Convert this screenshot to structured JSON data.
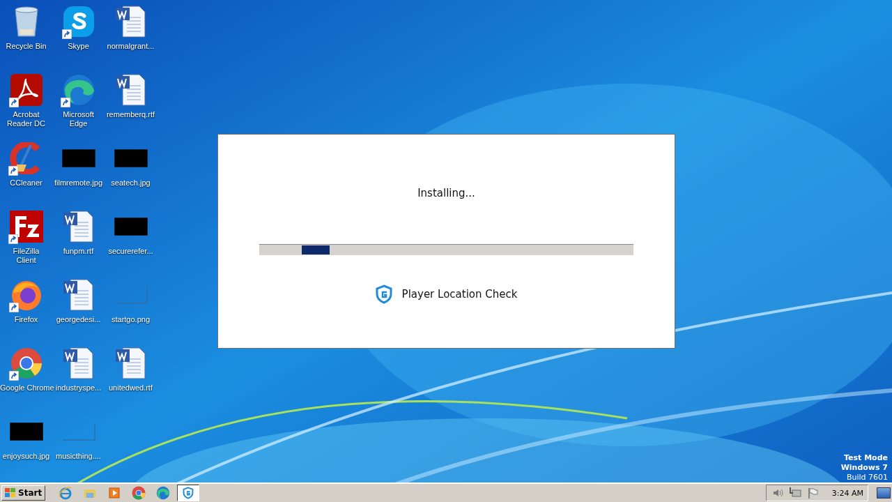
{
  "desktop_icons": [
    {
      "label": "Recycle Bin",
      "kind": "recycle",
      "shortcut": false
    },
    {
      "label": "Acrobat Reader DC",
      "kind": "pdf",
      "shortcut": true
    },
    {
      "label": "CCleaner",
      "kind": "ccleaner",
      "shortcut": true
    },
    {
      "label": "FileZilla Client",
      "kind": "filezilla",
      "shortcut": true
    },
    {
      "label": "Firefox",
      "kind": "firefox",
      "shortcut": true
    },
    {
      "label": "Google Chrome",
      "kind": "chrome",
      "shortcut": true
    },
    {
      "label": "enjoysuch.jpg",
      "kind": "dark-image",
      "shortcut": false
    },
    {
      "label": "Skype",
      "kind": "skype",
      "shortcut": true
    },
    {
      "label": "Microsoft Edge",
      "kind": "edge",
      "shortcut": true
    },
    {
      "label": "filmremote.jpg",
      "kind": "dark-image",
      "shortcut": false
    },
    {
      "label": "funpm.rtf",
      "kind": "word",
      "shortcut": false
    },
    {
      "label": "georgedesi...",
      "kind": "word",
      "shortcut": false
    },
    {
      "label": "industryspe...",
      "kind": "word",
      "shortcut": false
    },
    {
      "label": "musicthing....",
      "kind": "blank-image",
      "shortcut": false
    },
    {
      "label": "normalgrant...",
      "kind": "word",
      "shortcut": false
    },
    {
      "label": "rememberq.rtf",
      "kind": "word",
      "shortcut": false
    },
    {
      "label": "seatech.jpg",
      "kind": "dark-image",
      "shortcut": false
    },
    {
      "label": "securerefer...",
      "kind": "dark-image",
      "shortcut": false
    },
    {
      "label": "startgo.png",
      "kind": "blank-image",
      "shortcut": false
    },
    {
      "label": "unitedwed.rtf",
      "kind": "word",
      "shortcut": false
    }
  ],
  "dialog": {
    "status": "Installing...",
    "level": 0.074,
    "app_name": "Player Location Check"
  },
  "watermark": {
    "lines": [
      "Test Mode",
      "Windows 7",
      "Build 7601"
    ]
  },
  "taskbar": {
    "start": "Start",
    "items": [
      {
        "kind": "ie",
        "selected": false
      },
      {
        "kind": "explorer",
        "selected": false
      },
      {
        "kind": "media",
        "selected": false
      },
      {
        "kind": "chrome",
        "selected": false
      },
      {
        "kind": "edge",
        "selected": false
      },
      {
        "kind": "shield",
        "selected": true
      }
    ],
    "clock": "3:24 AM"
  }
}
